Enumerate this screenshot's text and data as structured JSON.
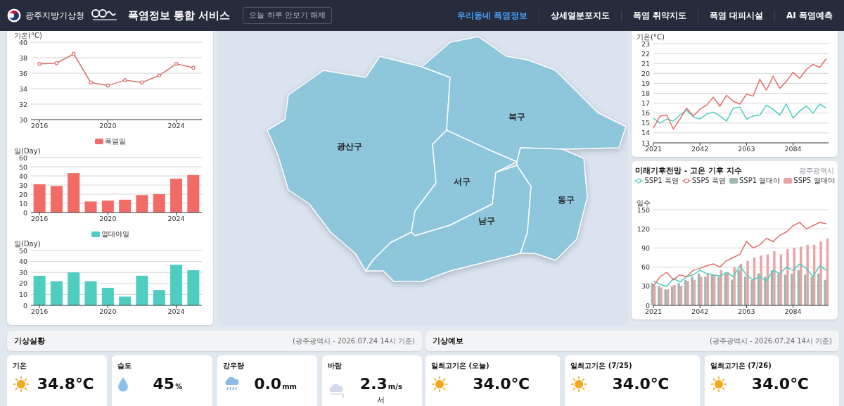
{
  "header": {
    "org_name": "광주지방기상청",
    "title": "폭염정보 통합 서비스",
    "hide_button": "오늘 하루 안보기 해제",
    "nav": [
      {
        "label": "우리동네 폭염정보",
        "selected": true
      },
      {
        "label": "상세열분포지도",
        "selected": false
      },
      {
        "label": "폭염 취약지도",
        "selected": false
      },
      {
        "label": "폭염 대피시설",
        "selected": false
      },
      {
        "label": "AI 폭염예측",
        "selected": false
      }
    ]
  },
  "history_charts": [
    {
      "chart_data": {
        "type": "line",
        "grid": true,
        "ylabel": "기온(°C)",
        "x": [
          2016,
          2017,
          2018,
          2019,
          2020,
          2021,
          2022,
          2023,
          2024,
          2025
        ],
        "xlim": [
          2015.5,
          2025.5
        ],
        "ylim": [
          30,
          40
        ],
        "xticks": [
          2016,
          2020,
          2024
        ],
        "yticks": [
          30,
          32,
          34,
          36,
          38,
          40
        ],
        "series": [
          {
            "marker": true,
            "color": "#d9706f",
            "values": [
              37.2,
              37.3,
              38.5,
              34.8,
              34.4,
              35.1,
              34.8,
              35.7,
              37.2,
              36.7
            ]
          }
        ]
      }
    },
    {
      "chart_data": {
        "type": "bar",
        "grid": true,
        "legend": "top",
        "ylabel": "일(Day)",
        "x": [
          2016,
          2017,
          2018,
          2019,
          2020,
          2021,
          2022,
          2023,
          2024,
          2025
        ],
        "xlim": [
          2015.5,
          2025.5
        ],
        "ylim": [
          0,
          60
        ],
        "xticks": [
          2016,
          2020,
          2024
        ],
        "yticks": [
          0,
          10,
          20,
          30,
          40,
          50,
          60
        ],
        "series": [
          {
            "name": "폭염일",
            "color": "#f16b67",
            "values": [
              31,
              29,
              43,
              12,
              13,
              14,
              19,
              20,
              37,
              41
            ]
          }
        ]
      }
    },
    {
      "chart_data": {
        "type": "bar",
        "grid": true,
        "legend": "top",
        "ylabel": "일(Day)",
        "x": [
          2016,
          2017,
          2018,
          2019,
          2020,
          2021,
          2022,
          2023,
          2024,
          2025
        ],
        "xlim": [
          2015.5,
          2025.5
        ],
        "ylim": [
          0,
          50
        ],
        "xticks": [
          2016,
          2020,
          2024
        ],
        "yticks": [
          0,
          10,
          20,
          30,
          40,
          50
        ],
        "series": [
          {
            "name": "열대야일",
            "color": "#4ecdc0",
            "values": [
              27,
              22,
              30,
              22,
              16,
              8,
              27,
              14,
              37,
              32
            ]
          }
        ]
      }
    }
  ],
  "map": {
    "districts": [
      {
        "name": "광산구"
      },
      {
        "name": "북구"
      },
      {
        "name": "서구"
      },
      {
        "name": "남구"
      },
      {
        "name": "동구"
      }
    ]
  },
  "temperature_projection": {
    "chart_data": {
      "type": "line",
      "grid": true,
      "ylabel": "기온(°C)",
      "x": [
        2021,
        2024,
        2027,
        2030,
        2033,
        2036,
        2039,
        2042,
        2045,
        2048,
        2051,
        2054,
        2057,
        2060,
        2063,
        2066,
        2069,
        2072,
        2075,
        2078,
        2081,
        2084,
        2087,
        2090,
        2093,
        2096,
        2099
      ],
      "xlim": [
        2021,
        2100
      ],
      "ylim": [
        13,
        23
      ],
      "xticks": [
        2021,
        2042,
        2063,
        2084
      ],
      "yticks": [
        13,
        14,
        15,
        16,
        17,
        18,
        19,
        20,
        21,
        22,
        23
      ],
      "series": [
        {
          "color": "#4ecdc0",
          "values": [
            15.5,
            15.0,
            15.4,
            15.2,
            15.8,
            16.3,
            15.6,
            15.4,
            15.9,
            16.1,
            15.7,
            15.2,
            16.5,
            16.6,
            15.4,
            15.7,
            15.8,
            16.8,
            16.4,
            15.8,
            16.9,
            15.5,
            16.2,
            16.7,
            16.0,
            16.9,
            16.5
          ]
        },
        {
          "color": "#e26d6a",
          "values": [
            14.5,
            15.7,
            15.8,
            14.4,
            15.4,
            16.5,
            15.7,
            16.4,
            16.8,
            17.6,
            16.7,
            17.8,
            17.2,
            16.9,
            17.9,
            17.7,
            19.4,
            18.3,
            19.7,
            18.5,
            19.2,
            20.1,
            19.5,
            20.4,
            20.9,
            20.6,
            21.5
          ]
        }
      ]
    }
  },
  "heat_index_projection": {
    "title": "미래기후전망 - 고온 기후 지수",
    "region": "광주광역시",
    "chart_data": {
      "type": "bar",
      "grid": true,
      "legend": "top",
      "ylabel": "일수",
      "x": [
        2021,
        2024,
        2027,
        2030,
        2033,
        2036,
        2039,
        2042,
        2045,
        2048,
        2051,
        2054,
        2057,
        2060,
        2063,
        2066,
        2069,
        2072,
        2075,
        2078,
        2081,
        2084,
        2087,
        2090,
        2093,
        2096,
        2099
      ],
      "xlim": [
        2021,
        2100
      ],
      "ylim": [
        0,
        150
      ],
      "xticks": [
        2021,
        2042,
        2063,
        2084
      ],
      "yticks": [
        0,
        30,
        60,
        90,
        120,
        150
      ],
      "series": [
        {
          "type": "line",
          "name": "SSP1 폭염",
          "color": "#4ecdc0",
          "values": [
            38,
            33,
            30,
            42,
            37,
            45,
            48,
            55,
            50,
            48,
            46,
            52,
            45,
            62,
            48,
            40,
            45,
            38,
            55,
            50,
            60,
            55,
            65,
            58,
            45,
            62,
            55
          ]
        },
        {
          "type": "line",
          "name": "SSP5 폭염",
          "color": "#e26d6a",
          "values": [
            30,
            45,
            52,
            40,
            48,
            45,
            55,
            58,
            62,
            65,
            60,
            70,
            75,
            80,
            100,
            90,
            95,
            105,
            100,
            110,
            115,
            125,
            130,
            120,
            125,
            130,
            128
          ]
        },
        {
          "name": "SSP1 열대야",
          "color": "#9fb7b0",
          "values": [
            35,
            30,
            25,
            30,
            35,
            40,
            45,
            50,
            45,
            48,
            45,
            50,
            40,
            55,
            45,
            40,
            50,
            45,
            55,
            50,
            48,
            50,
            55,
            48,
            45,
            50,
            40
          ]
        },
        {
          "name": "SSP5 열대야",
          "color": "#e7a5a3",
          "values": [
            30,
            28,
            25,
            32,
            30,
            38,
            40,
            45,
            50,
            48,
            55,
            52,
            60,
            65,
            70,
            75,
            78,
            80,
            85,
            80,
            88,
            90,
            92,
            95,
            95,
            100,
            105
          ]
        }
      ]
    }
  },
  "current_weather": {
    "title": "기상실황",
    "timestamp": "(광주광역시 - 2026.07.24 14시 기준)",
    "items": [
      {
        "kind": "sun",
        "label": "기온",
        "value": "34.8℃"
      },
      {
        "kind": "drop",
        "label": "습도",
        "value": "45",
        "unit": "%"
      },
      {
        "kind": "rain",
        "label": "강우량",
        "value": "0.0",
        "unit": "mm"
      },
      {
        "kind": "wind",
        "label": "바람",
        "value": "2.3",
        "unit": "m/s",
        "direction": "서"
      }
    ]
  },
  "forecast": {
    "title": "기상예보",
    "timestamp": "(광주광역시 - 2026.07.24 14시 기준)",
    "items": [
      {
        "kind": "sun",
        "label": "일최고기온 (오늘)",
        "value": "34.0℃"
      },
      {
        "kind": "sun",
        "label": "일최고기온 (7/25)",
        "value": "34.0℃"
      },
      {
        "kind": "sun",
        "label": "일최고기온 (7/26)",
        "value": "34.0℃"
      }
    ]
  }
}
